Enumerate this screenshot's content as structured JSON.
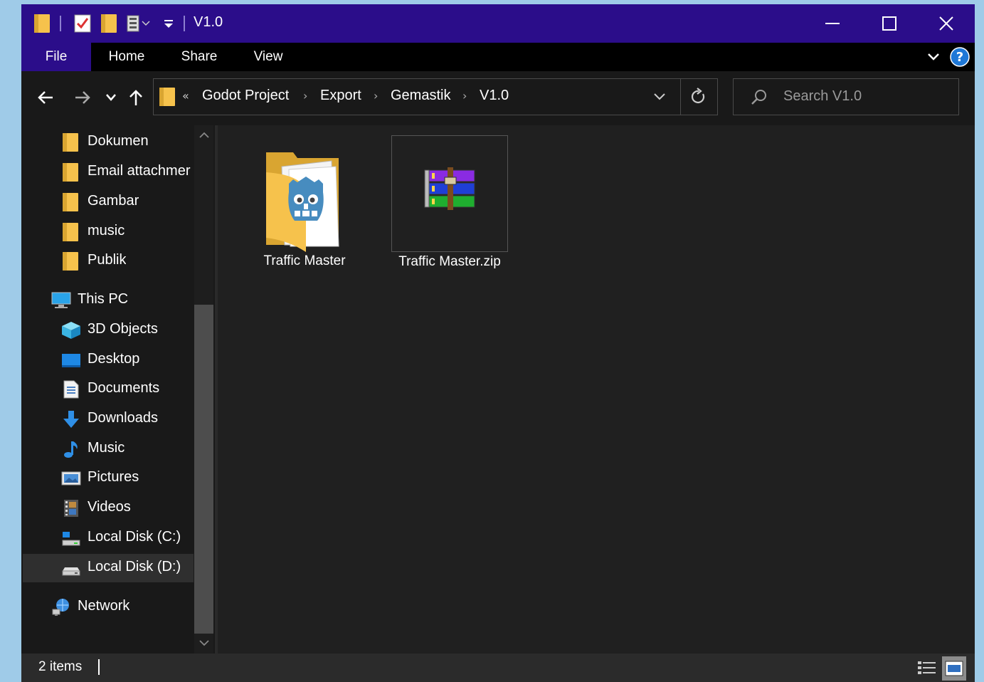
{
  "window": {
    "title": "V1.0"
  },
  "ribbon": {
    "tabs": [
      {
        "label": "File"
      },
      {
        "label": "Home"
      },
      {
        "label": "Share"
      },
      {
        "label": "View"
      }
    ]
  },
  "address": {
    "overflow": "«",
    "crumbs": [
      "Godot Project",
      "Export",
      "Gemastik",
      "V1.0"
    ]
  },
  "search": {
    "placeholder": "Search V1.0"
  },
  "sidebar": {
    "items": [
      {
        "label": "Dokumen",
        "icon": "folder-icon"
      },
      {
        "label": "Email attachmer",
        "icon": "folder-icon"
      },
      {
        "label": "Gambar",
        "icon": "folder-icon"
      },
      {
        "label": "music",
        "icon": "folder-icon"
      },
      {
        "label": "Publik",
        "icon": "folder-icon"
      },
      {
        "label": "This PC",
        "icon": "this-pc-icon"
      },
      {
        "label": "3D Objects",
        "icon": "3d-objects-icon"
      },
      {
        "label": "Desktop",
        "icon": "desktop-icon"
      },
      {
        "label": "Documents",
        "icon": "documents-icon"
      },
      {
        "label": "Downloads",
        "icon": "downloads-icon"
      },
      {
        "label": "Music",
        "icon": "music-icon"
      },
      {
        "label": "Pictures",
        "icon": "pictures-icon"
      },
      {
        "label": "Videos",
        "icon": "videos-icon"
      },
      {
        "label": "Local Disk (C:)",
        "icon": "local-disk-c-icon"
      },
      {
        "label": "Local Disk (D:)",
        "icon": "local-disk-d-icon",
        "selected": true
      },
      {
        "label": "Network",
        "icon": "network-icon"
      }
    ]
  },
  "files": [
    {
      "name": "Traffic Master",
      "icon": "godot-folder-icon"
    },
    {
      "name": "Traffic Master.zip",
      "icon": "winrar-archive-icon"
    }
  ],
  "status": {
    "count": "2 items"
  },
  "colors": {
    "titlebar": "#2b0d8a",
    "ribbon": "#000000",
    "background": "#191919",
    "content": "#202020",
    "folder": "#f6c24c",
    "accent": "#2b0d8a"
  }
}
